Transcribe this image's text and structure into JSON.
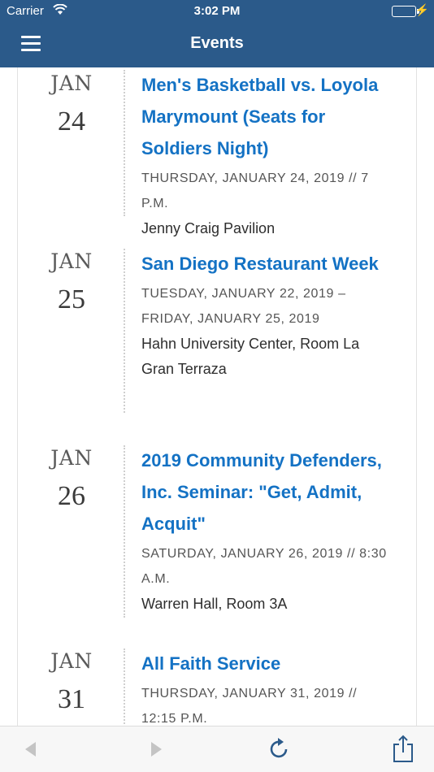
{
  "status_bar": {
    "carrier": "Carrier",
    "time": "3:02 PM"
  },
  "nav": {
    "title": "Events"
  },
  "events": [
    {
      "month": "JAN",
      "day": "24",
      "title": "Men's Basketball vs. Loyola Marymount (Seats for Soldiers Night)",
      "date": "THURSDAY, JANUARY 24, 2019 // 7 P.M.",
      "location": "Jenny Craig Pavilion"
    },
    {
      "month": "JAN",
      "day": "25",
      "title": "San Diego Restaurant Week",
      "date": "TUESDAY, JANUARY 22, 2019 – FRIDAY, JANUARY 25, 2019",
      "location": "Hahn University Center, Room La Gran Terraza"
    },
    {
      "month": "JAN",
      "day": "26",
      "title": "2019 Community Defenders, Inc. Seminar: \"Get, Admit, Acquit\"",
      "date": "SATURDAY, JANUARY 26, 2019 // 8:30 A.M.",
      "location": "Warren Hall, Room 3A"
    },
    {
      "month": "JAN",
      "day": "31",
      "title": "All Faith Service",
      "date": "THURSDAY, JANUARY 31, 2019 // 12:15 P.M.",
      "location": ""
    }
  ],
  "toolbar": {
    "icons": [
      "back-arrow-icon",
      "forward-arrow-icon",
      "reload-icon",
      "share-icon"
    ]
  },
  "colors": {
    "nav": "#2b5a8a",
    "title_link": "#1472c4",
    "battery": "#4cd964"
  }
}
